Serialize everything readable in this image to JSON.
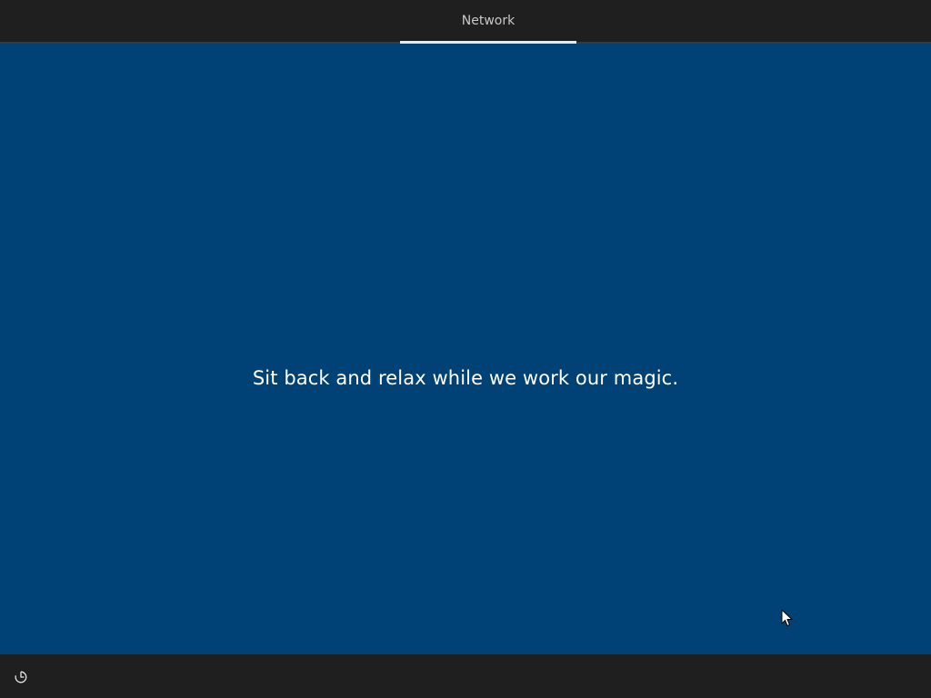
{
  "header": {
    "tabs": [
      {
        "label": "Network",
        "active": true
      }
    ]
  },
  "main": {
    "message": "Sit back and relax while we work our magic."
  },
  "footer": {
    "ease_of_access_icon": "ease-of-access-icon"
  },
  "colors": {
    "background": "#004275",
    "bar": "#1f1f1f",
    "text": "#ffffff",
    "tab_text": "#c8c8c8",
    "tab_underline": "#e8e8e8"
  }
}
